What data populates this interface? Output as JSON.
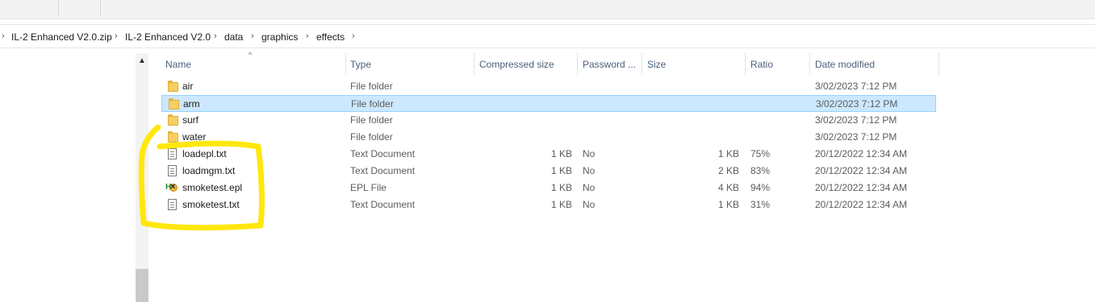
{
  "breadcrumb": {
    "items": [
      "IL-2 Enhanced V2.0.zip",
      "IL-2 Enhanced V2.0",
      "data",
      "graphics",
      "effects"
    ]
  },
  "columns": {
    "name": "Name",
    "type": "Type",
    "compressed_size": "Compressed size",
    "password": "Password ...",
    "size": "Size",
    "ratio": "Ratio",
    "date_modified": "Date modified"
  },
  "files": [
    {
      "name": "air",
      "icon": "folder-icon",
      "type": "File folder",
      "compressed_size": "",
      "password": "",
      "size": "",
      "ratio": "",
      "date": "3/02/2023 7:12 PM",
      "selected": false
    },
    {
      "name": "arm",
      "icon": "folder-icon",
      "type": "File folder",
      "compressed_size": "",
      "password": "",
      "size": "",
      "ratio": "",
      "date": "3/02/2023 7:12 PM",
      "selected": true
    },
    {
      "name": "surf",
      "icon": "folder-icon",
      "type": "File folder",
      "compressed_size": "",
      "password": "",
      "size": "",
      "ratio": "",
      "date": "3/02/2023 7:12 PM",
      "selected": false
    },
    {
      "name": "water",
      "icon": "folder-icon",
      "type": "File folder",
      "compressed_size": "",
      "password": "",
      "size": "",
      "ratio": "",
      "date": "3/02/2023 7:12 PM",
      "selected": false
    },
    {
      "name": "loadepl.txt",
      "icon": "text-document-icon",
      "type": "Text Document",
      "compressed_size": "1 KB",
      "password": "No",
      "size": "1 KB",
      "ratio": "75%",
      "date": "20/12/2022 12:34 AM",
      "selected": false
    },
    {
      "name": "loadmgm.txt",
      "icon": "text-document-icon",
      "type": "Text Document",
      "compressed_size": "1 KB",
      "password": "No",
      "size": "2 KB",
      "ratio": "83%",
      "date": "20/12/2022 12:34 AM",
      "selected": false
    },
    {
      "name": "smoketest.epl",
      "icon": "epl-file-icon",
      "type": "EPL File",
      "compressed_size": "1 KB",
      "password": "No",
      "size": "4 KB",
      "ratio": "94%",
      "date": "20/12/2022 12:34 AM",
      "selected": false
    },
    {
      "name": "smoketest.txt",
      "icon": "text-document-icon",
      "type": "Text Document",
      "compressed_size": "1 KB",
      "password": "No",
      "size": "1 KB",
      "ratio": "31%",
      "date": "20/12/2022 12:34 AM",
      "selected": false
    }
  ],
  "colors": {
    "selection_bg": "#cce8ff",
    "selection_border": "#99d1ff",
    "annotation": "#ffe600",
    "header_text": "#4c607a"
  }
}
